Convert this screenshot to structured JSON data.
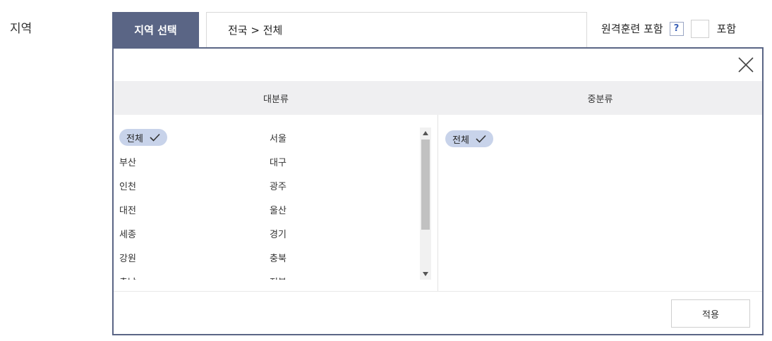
{
  "form": {
    "label": "지역",
    "region_tab": "지역 선택",
    "path": "전국 > 전체",
    "remote": {
      "label": "원격훈련 포함",
      "help": "?",
      "checkbox_label": "포함",
      "checked": false
    }
  },
  "panel": {
    "close_icon": "close-icon",
    "major_header": "대분류",
    "middle_header": "중분류",
    "major_items": [
      {
        "label": "전체",
        "selected": true
      },
      {
        "label": "서울",
        "selected": false
      },
      {
        "label": "부산",
        "selected": false
      },
      {
        "label": "대구",
        "selected": false
      },
      {
        "label": "인천",
        "selected": false
      },
      {
        "label": "광주",
        "selected": false
      },
      {
        "label": "대전",
        "selected": false
      },
      {
        "label": "울산",
        "selected": false
      },
      {
        "label": "세종",
        "selected": false
      },
      {
        "label": "경기",
        "selected": false
      },
      {
        "label": "강원",
        "selected": false
      },
      {
        "label": "충북",
        "selected": false
      },
      {
        "label": "충남",
        "selected": false
      },
      {
        "label": "전북",
        "selected": false
      }
    ],
    "middle_items": [
      {
        "label": "전체",
        "selected": true
      }
    ],
    "apply_label": "적용"
  },
  "colors": {
    "accent": "#5a6585",
    "pill": "#c8d3ea",
    "header_bg": "#efeff1",
    "help": "#3e63b8"
  }
}
